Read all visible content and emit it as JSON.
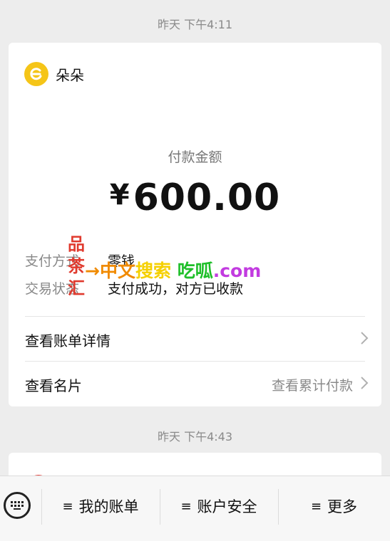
{
  "messages": [
    {
      "timestamp": "昨天 下午4:11",
      "sender": "朵朵",
      "amount_label": "付款金额",
      "currency": "¥",
      "amount": "600.00",
      "details": [
        {
          "key": "支付方式",
          "value": "零钱"
        },
        {
          "key": "交易状态",
          "value": "支付成功，对方已收款"
        }
      ],
      "links": [
        {
          "label": "查看账单详情",
          "hint": ""
        },
        {
          "label": "查看名片",
          "hint": "查看累计付款"
        }
      ]
    },
    {
      "timestamp": "昨天 下午4:43"
    }
  ],
  "watermark": {
    "vertical": [
      "品",
      "茶",
      "汇"
    ],
    "line_parts": [
      "→中文",
      "搜索",
      "吃呱",
      ".com"
    ]
  },
  "bottom_menu": {
    "items": [
      "我的账单",
      "账户安全",
      "更多"
    ]
  },
  "colors": {
    "background": "#ededed",
    "card": "#ffffff",
    "avatar": "#f5c518"
  }
}
